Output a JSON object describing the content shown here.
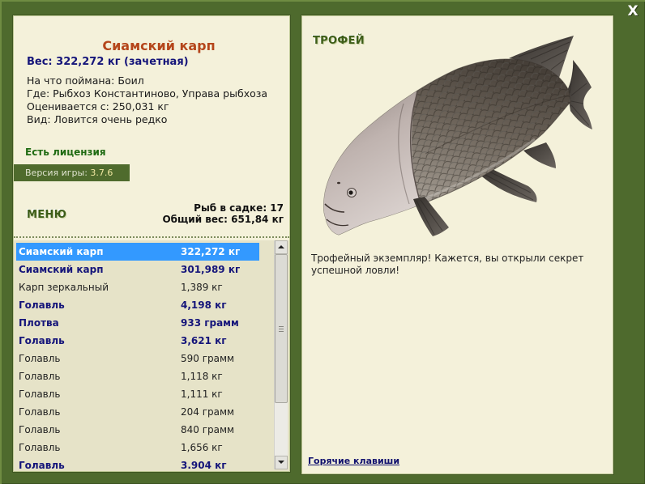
{
  "window": {
    "close_label": "X",
    "colors": {
      "frame": "#4e6a2d",
      "panel": "#f4f1da",
      "list_bg": "#e6e3c8",
      "version_bar": "#4f6b2d",
      "selection": "#3399ff",
      "title": "#b5461b",
      "emphasis": "#15157a",
      "license": "#1f6b12",
      "link": "#10106e"
    }
  },
  "fish_info": {
    "name": "Сиамский карп",
    "weight_line": "Вес: 322,272 кг (зачетная)",
    "details": [
      "На что поймана: Боил",
      "Где: Рыбхоз Константиново, Управа рыбхоза",
      "Оценивается с: 250,031 кг",
      "Вид: Ловится очень редко"
    ]
  },
  "license": "Есть лицензия",
  "version": {
    "label": "Версия игры:",
    "value": "3.7.6"
  },
  "menu_label": "МЕНЮ",
  "keepnet": {
    "count_line": "Рыб в садке: 17",
    "total_line": "Общий вес: 651,84 кг"
  },
  "catch_list": {
    "selected_index": 0,
    "scroll": {
      "position": 0,
      "visible_fraction": 0.74
    },
    "items": [
      {
        "name": "Сиамский карп",
        "weight": "322,272 кг",
        "bold": true
      },
      {
        "name": "Сиамский карп",
        "weight": "301,989 кг",
        "bold": true
      },
      {
        "name": "Карп зеркальный",
        "weight": "1,389 кг",
        "bold": false
      },
      {
        "name": "Голавль",
        "weight": "4,198 кг",
        "bold": true
      },
      {
        "name": "Плотва",
        "weight": "933 грамм",
        "bold": true
      },
      {
        "name": "Голавль",
        "weight": "3,621 кг",
        "bold": true
      },
      {
        "name": "Голавль",
        "weight": "590 грамм",
        "bold": false
      },
      {
        "name": "Голавль",
        "weight": "1,118 кг",
        "bold": false
      },
      {
        "name": "Голавль",
        "weight": "1,111 кг",
        "bold": false
      },
      {
        "name": "Голавль",
        "weight": "204 грамм",
        "bold": false
      },
      {
        "name": "Голавль",
        "weight": "840 грамм",
        "bold": false
      },
      {
        "name": "Голавль",
        "weight": "1,656 кг",
        "bold": false
      },
      {
        "name": "Голавль",
        "weight": "3.904 кг",
        "bold": true
      }
    ]
  },
  "trophy": {
    "badge": "ТРОФЕЙ",
    "image_icon": "fish-image",
    "description": "Трофейный экземпляр! Кажется, вы открыли секрет успешной ловли!"
  },
  "hotkeys_link": "Горячие клавиши"
}
